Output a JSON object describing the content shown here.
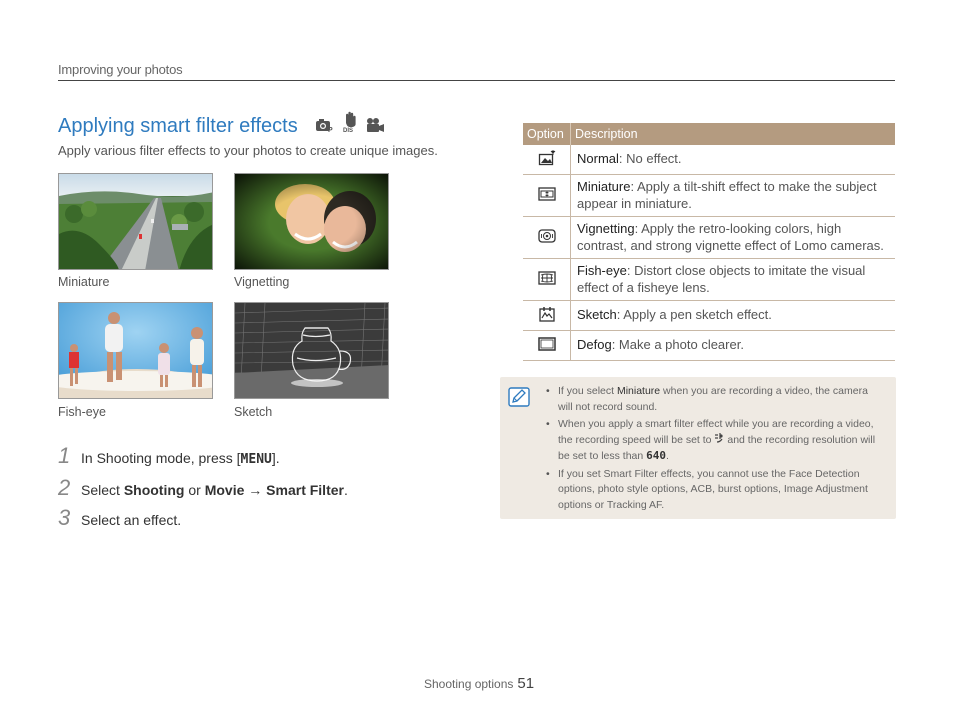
{
  "header": {
    "section": "Improving your photos"
  },
  "title": "Applying smart filter effects",
  "mode_icons": [
    "camera-program-icon",
    "dual-is-icon",
    "movie-icon"
  ],
  "intro": "Apply various filter effects to your photos to create unique images.",
  "photos": [
    {
      "caption": "Miniature",
      "image": "highway-aerial-image"
    },
    {
      "caption": "Vignetting",
      "image": "couple-on-grass-image"
    },
    {
      "caption": "Fish-eye",
      "image": "family-on-beach-image"
    },
    {
      "caption": "Sketch",
      "image": "sketch-glass-jar-image"
    }
  ],
  "steps": [
    {
      "num": "1",
      "pre": "In Shooting mode, press [",
      "key": "MENU",
      "post": "]."
    },
    {
      "num": "2",
      "pre": "Select ",
      "b1": "Shooting",
      "mid": " or ",
      "b2": "Movie",
      "arrow": " → ",
      "b3": "Smart Filter",
      "post": "."
    },
    {
      "num": "3",
      "text": "Select an effect."
    }
  ],
  "table": {
    "headers": [
      "Option",
      "Description"
    ],
    "rows": [
      {
        "icon": "normal-filter-icon",
        "name": "Normal",
        "desc": ": No effect."
      },
      {
        "icon": "miniature-filter-icon",
        "name": "Miniature",
        "desc": ": Apply a tilt-shift effect to make the subject appear in miniature."
      },
      {
        "icon": "vignetting-filter-icon",
        "name": "Vignetting",
        "desc": ": Apply the retro-looking colors, high contrast, and strong vignette effect of Lomo cameras."
      },
      {
        "icon": "fisheye-filter-icon",
        "name": "Fish-eye",
        "desc": ": Distort close objects to imitate the visual effect of a fisheye lens."
      },
      {
        "icon": "sketch-filter-icon",
        "name": "Sketch",
        "desc": ": Apply a pen sketch effect."
      },
      {
        "icon": "defog-filter-icon",
        "name": "Defog",
        "desc": ": Make a photo clearer."
      }
    ]
  },
  "note": {
    "icon": "note-pencil-icon",
    "items": [
      {
        "pre": "If you select ",
        "b": "Miniature",
        "post": " when you are recording a video, the camera will not record sound."
      },
      {
        "pre": "When you apply a smart filter effect while you are recording a video, the recording speed will be set to ",
        "sym1": "slow-speed-icon",
        "mid": " and the recording resolution will be set to less than ",
        "res": "640",
        "post": "."
      },
      {
        "text": "If you set Smart Filter effects, you cannot use the Face Detection options, photo style options, ACB, burst options, Image Adjustment options or Tracking AF."
      }
    ]
  },
  "footer": {
    "label": "Shooting options",
    "page": "51"
  }
}
